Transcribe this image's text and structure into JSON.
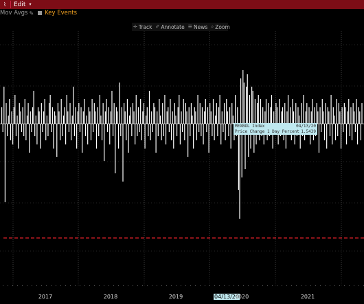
{
  "titlebar": {
    "chart_icon": "chart-icon",
    "edit_label": "Edit",
    "arrow": "▾"
  },
  "options": {
    "mov_avgs_label": "Mov Avgs",
    "key_events_label": "Key Events"
  },
  "toolbar": {
    "track_label": "Track",
    "annotate_label": "Annotate",
    "news_label": "News",
    "zoom_label": "Zoom"
  },
  "tooltip": {
    "ticker": "MEXBOL Index",
    "date": "04/13/20",
    "field": "Price Change 1 Day Percent",
    "value": "1.5439"
  },
  "colors": {
    "accent": "#7d0d16",
    "threshold_line": "#e0202a",
    "tooltip_bg": "#bfe8ef",
    "key_events": "#f0a020"
  },
  "chart_data": {
    "type": "bar",
    "title": "",
    "xlabel": "",
    "ylabel": "",
    "x_ticks": [
      "2017",
      "2018",
      "2019",
      "2020",
      "2021"
    ],
    "x_highlight": "04/13/20",
    "threshold_style": "dashed red horizontal line",
    "series": [
      {
        "values_normalized": [
          0.4,
          -0.2,
          0.9,
          -1.9,
          0.5,
          -0.3,
          0.2,
          0.6,
          -0.4,
          0.3,
          -0.5,
          0.4,
          0.7,
          -0.3,
          0.2,
          -0.6,
          0.5,
          0.3,
          -0.2,
          0.4,
          -0.3,
          0.6,
          -0.4,
          0.2,
          0.5,
          -0.7,
          0.3,
          -0.2,
          0.4,
          0.8,
          -0.3,
          0.2,
          -0.5,
          0.4,
          0.3,
          -0.6,
          0.5,
          -0.2,
          0.3,
          0.6,
          -0.4,
          0.2,
          -0.3,
          0.5,
          0.7,
          -0.2,
          0.4,
          -0.6,
          0.3,
          0.2,
          -0.8,
          0.5,
          0.3,
          -0.4,
          0.6,
          -0.3,
          0.2,
          0.4,
          -0.5,
          0.7,
          0.3,
          -0.2,
          0.5,
          -0.4,
          0.2,
          0.9,
          -0.3,
          0.4,
          -0.6,
          0.3,
          0.5,
          -0.2,
          0.4,
          -0.7,
          0.3,
          0.6,
          -0.3,
          0.2,
          -0.5,
          0.4,
          0.3,
          -0.4,
          0.6,
          -0.2,
          0.5,
          0.3,
          -0.6,
          0.4,
          -0.3,
          0.7,
          0.2,
          -0.4,
          0.5,
          -0.9,
          0.3,
          0.6,
          -0.2,
          0.4,
          -0.5,
          0.3,
          0.8,
          -0.3,
          0.5,
          -1.2,
          0.4,
          0.3,
          -0.6,
          1.0,
          -0.3,
          0.4,
          -1.4,
          0.5,
          0.3,
          -0.4,
          0.6,
          -0.7,
          0.2,
          0.4,
          -0.3,
          0.5,
          0.3,
          -0.5,
          0.7,
          -0.3,
          0.4,
          -0.2,
          0.6,
          -0.4,
          0.3,
          0.5,
          -0.6,
          0.2,
          0.4,
          -0.3,
          0.8,
          -0.4,
          0.3,
          -0.2,
          0.5,
          0.4,
          -0.7,
          0.3,
          -0.3,
          0.6,
          0.2,
          -0.4,
          0.5,
          -0.3,
          0.7,
          -0.5,
          0.3,
          0.4,
          -0.2,
          0.6,
          -0.4,
          0.3,
          -0.6,
          0.5,
          0.2,
          -0.3,
          0.4,
          0.7,
          -0.5,
          0.3,
          -0.2,
          0.6,
          -0.4,
          0.5,
          0.3,
          -0.8,
          0.4,
          -0.3,
          0.5,
          0.2,
          -0.6,
          0.4,
          0.3,
          -0.4,
          0.7,
          -0.2,
          0.5,
          -0.3,
          0.4,
          -0.5,
          0.3,
          0.6,
          -0.2,
          0.4,
          -0.7,
          0.5,
          0.3,
          -0.3,
          0.6,
          -0.4,
          0.2,
          0.5,
          -0.3,
          0.4,
          0.7,
          -0.5,
          0.3,
          -0.2,
          0.5,
          -0.4,
          0.6,
          0.3,
          -0.3,
          0.4,
          -0.6,
          0.5,
          0.2,
          -0.4,
          0.7,
          -0.3,
          0.4,
          -1.6,
          -2.3,
          1.1,
          -1.3,
          1.3,
          1.0,
          -1.1,
          0.9,
          1.2,
          -0.8,
          0.7,
          -0.6,
          0.9,
          0.8,
          -0.7,
          0.6,
          -0.5,
          0.5,
          0.7,
          -0.4,
          0.6,
          -0.3,
          0.4,
          -0.5,
          0.3,
          0.6,
          -0.4,
          0.5,
          -0.3,
          0.4,
          0.7,
          -0.6,
          0.3,
          -0.2,
          0.5,
          0.4,
          -0.5,
          0.6,
          -0.3,
          0.3,
          0.4,
          -0.4,
          0.5,
          -0.6,
          0.3,
          0.7,
          -0.2,
          0.4,
          -0.4,
          0.6,
          0.3,
          -0.5,
          0.5,
          -0.3,
          0.4,
          0.2,
          -0.6,
          0.5,
          -0.3,
          0.7,
          -0.4,
          0.3,
          0.5,
          -0.2,
          0.4,
          -0.5,
          0.3,
          0.6,
          -0.4,
          0.4,
          -0.3,
          0.5,
          0.3,
          -0.7,
          0.4,
          -0.2,
          0.6,
          0.3,
          -0.4,
          0.5,
          -0.6,
          0.4,
          0.3,
          -0.3,
          0.7,
          -0.5,
          0.4,
          0.2,
          -0.4,
          0.6,
          -0.3,
          0.5,
          0.3,
          -0.6,
          0.4,
          -0.2,
          0.5,
          0.4,
          -0.5,
          0.3,
          0.6,
          -0.3,
          0.4,
          -0.4,
          0.5,
          0.3,
          -0.2,
          0.6,
          -0.5,
          0.4,
          0.3,
          -0.4,
          0.5
        ]
      }
    ],
    "grid": "vertical dotted",
    "legend": "none"
  }
}
